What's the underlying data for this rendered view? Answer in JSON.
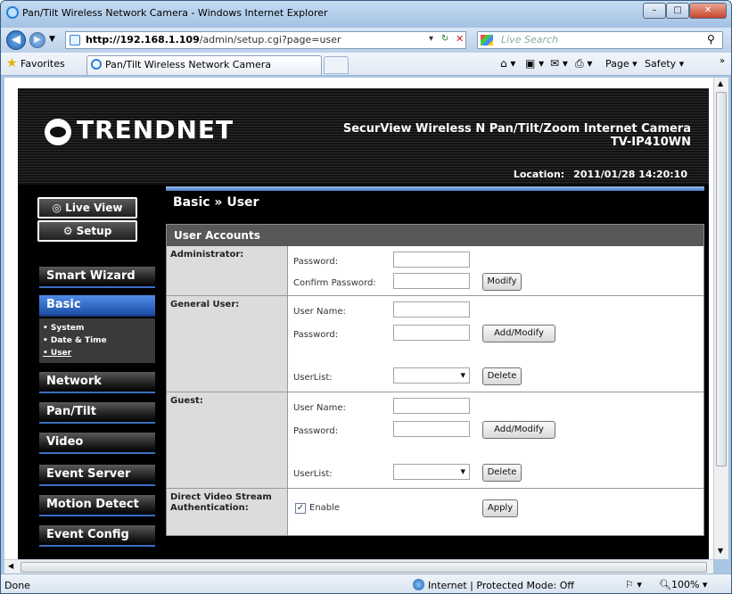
{
  "window": {
    "title": "Pan/Tilt Wireless Network Camera - Windows Internet Explorer",
    "min": "–",
    "max": "□",
    "close": "✕"
  },
  "address": {
    "url_host": "http://192.168.1.109",
    "url_path": "/admin/setup.cgi?page=user",
    "search_placeholder": "Live Search"
  },
  "favorites": {
    "label": "Favorites",
    "tab_title": "Pan/Tilt Wireless Network Camera",
    "commands": [
      "Page ▾",
      "Safety ▾"
    ]
  },
  "header": {
    "logo": "TRENDNET",
    "product_line": "SecurView Wireless N Pan/Tilt/Zoom Internet Camera",
    "model": "TV-IP410WN",
    "location_label": "Location:",
    "location_value": "2011/01/28 14:20:10"
  },
  "sidebar": {
    "live_view": "Live View",
    "setup": "Setup",
    "menu": [
      "Smart Wizard",
      "Basic",
      "Network",
      "Pan/Tilt",
      "Video",
      "Event Server",
      "Motion Detect",
      "Event Config"
    ],
    "basic_sub": [
      "• System",
      "• Date & Time",
      "• User"
    ]
  },
  "main": {
    "breadcrumb": "Basic » User",
    "panel_title": "User Accounts",
    "admin": {
      "label": "Administrator:",
      "password": "Password:",
      "confirm": "Confirm Password:",
      "modify": "Modify"
    },
    "general": {
      "label": "General User:",
      "username": "User Name:",
      "password": "Password:",
      "add": "Add/Modify",
      "userlist": "UserList:",
      "delete": "Delete"
    },
    "guest": {
      "label": "Guest:",
      "username": "User Name:",
      "password": "Password:",
      "add": "Add/Modify",
      "userlist": "UserList:",
      "delete": "Delete"
    },
    "dvs": {
      "label": "Direct Video Stream Authentication:",
      "enable": "Enable",
      "checked": true,
      "apply": "Apply"
    }
  },
  "status": {
    "left": "Done",
    "zone": "Internet | Protected Mode: Off",
    "zoom": "100%"
  }
}
